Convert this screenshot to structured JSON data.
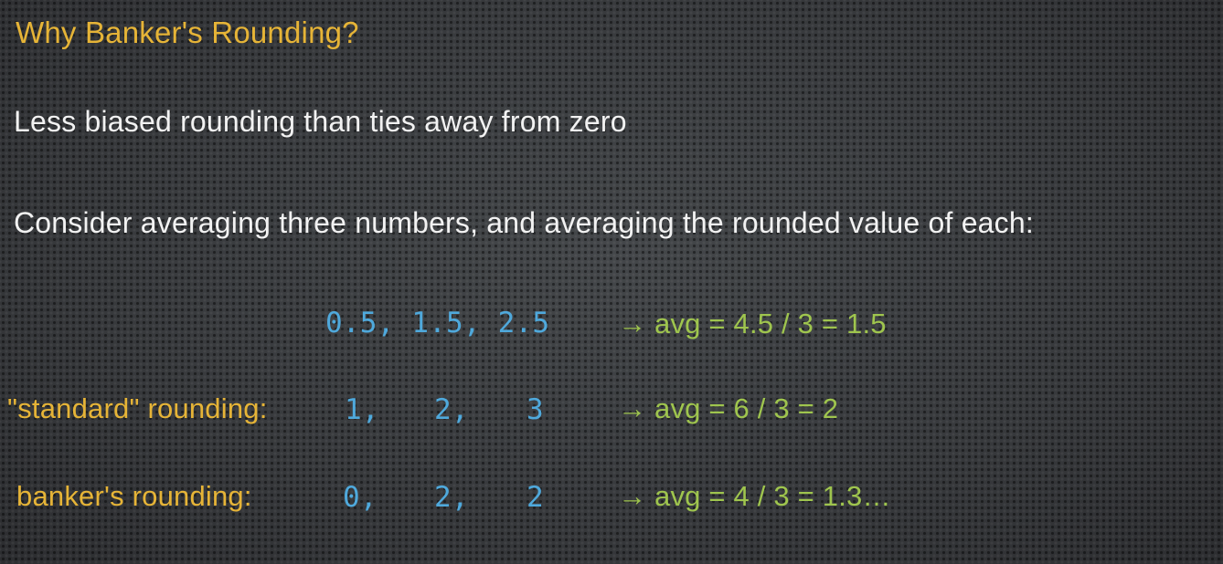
{
  "slide": {
    "title": "Why Banker's Rounding?",
    "point1": "Less biased rounding than ties away from zero",
    "point2": "Consider averaging three numbers, and averaging the rounded  value of each:"
  },
  "example": {
    "original": {
      "values": "0.5, 1.5, 2.5",
      "result": "→ avg = 4.5 / 3 = 1.5"
    },
    "standard": {
      "label": "\"standard\" rounding:",
      "values": [
        "1,",
        "2,",
        "3"
      ],
      "result": "→ avg = 6 / 3 = 2"
    },
    "banker": {
      "label": "banker's rounding:",
      "values": [
        "0,",
        "2,",
        "2"
      ],
      "result": "→ avg = 4 / 3 = 1.3…"
    }
  },
  "colors": {
    "heading": "#e6b437",
    "body_text": "#f2f2f2",
    "code_values": "#4fa9dc",
    "results": "#9fc54e",
    "background": "#3b3d40"
  }
}
